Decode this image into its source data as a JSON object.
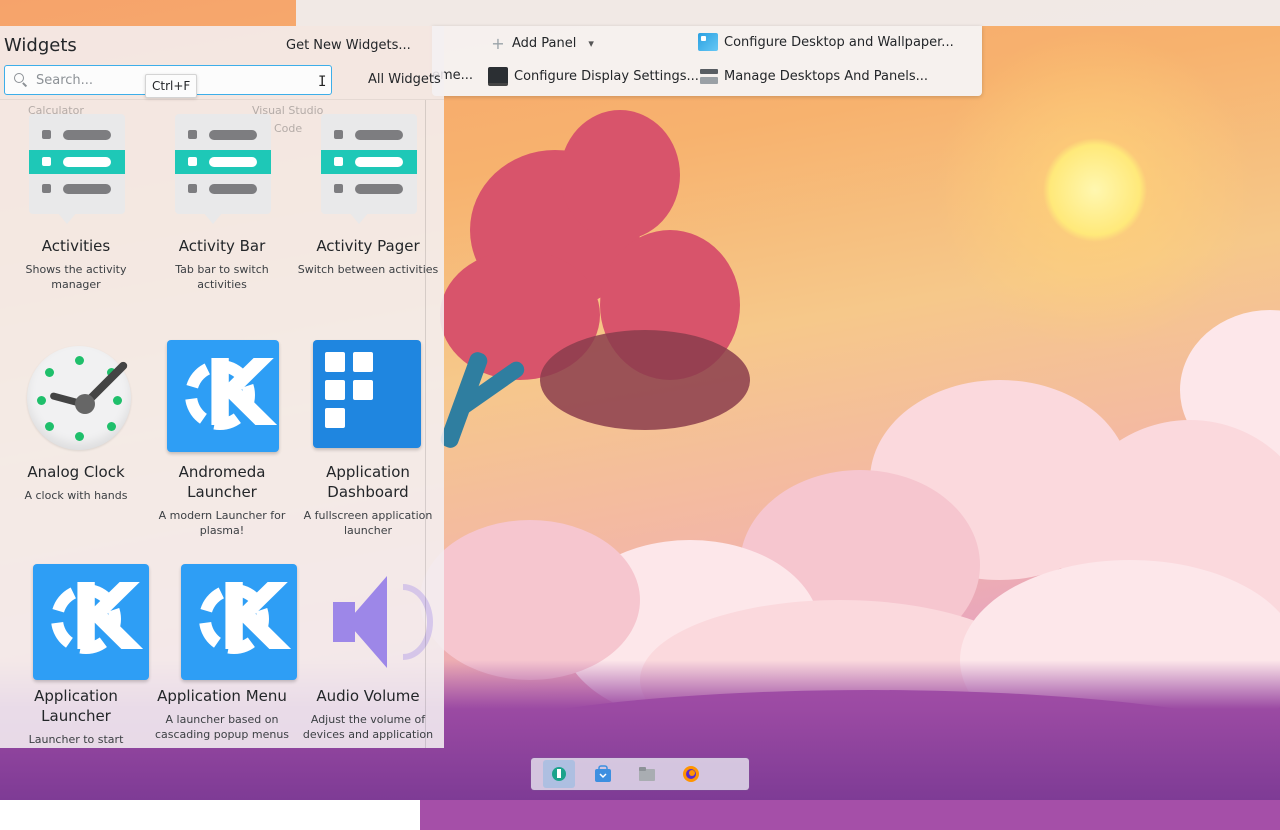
{
  "toolbox": {
    "add_panel": "Add Panel",
    "global_themes_partial": "eme...",
    "configure_display": "Configure Display Settings...",
    "configure_desktop": "Configure Desktop and Wallpaper...",
    "manage_desktops": "Manage Desktops And Panels..."
  },
  "sidebar": {
    "title": "Widgets",
    "get_new": "Get New Widgets...",
    "search_placeholder": "Search...",
    "filter": "All Widgets",
    "tooltip": "Ctrl+F",
    "ghost_labels": [
      "Calculator",
      "Visual Studio",
      "Code"
    ],
    "widgets": [
      {
        "name": "Activities",
        "desc": "Shows the activity manager",
        "icon": "activities-icon"
      },
      {
        "name": "Activity Bar",
        "desc": "Tab bar to switch activities",
        "icon": "activities-icon"
      },
      {
        "name": "Activity Pager",
        "desc": "Switch between activities",
        "icon": "activities-icon"
      },
      {
        "name": "Analog Clock",
        "desc": "A clock with hands",
        "icon": "analog-clock-icon"
      },
      {
        "name": "Andromeda Launcher",
        "desc": "A modern Launcher for plasma!",
        "icon": "kde-icon"
      },
      {
        "name": "Application Dashboard",
        "desc": "A fullscreen application launcher",
        "icon": "dashboard-icon"
      },
      {
        "name": "Application Launcher",
        "desc": "Launcher to start",
        "icon": "kde-icon"
      },
      {
        "name": "Application Menu",
        "desc": "A launcher based on cascading popup menus",
        "icon": "kde-icon"
      },
      {
        "name": "Audio Volume",
        "desc": "Adjust the volume of devices and application",
        "icon": "speaker-icon"
      }
    ]
  },
  "taskbar": {
    "items": [
      "widgets-explorer-icon",
      "store-icon",
      "folder-icon",
      "firefox-icon"
    ]
  },
  "colors": {
    "accent": "#3daee9",
    "activity_teal": "#1ec8b7",
    "kde_blue": "#2e9ef5"
  }
}
